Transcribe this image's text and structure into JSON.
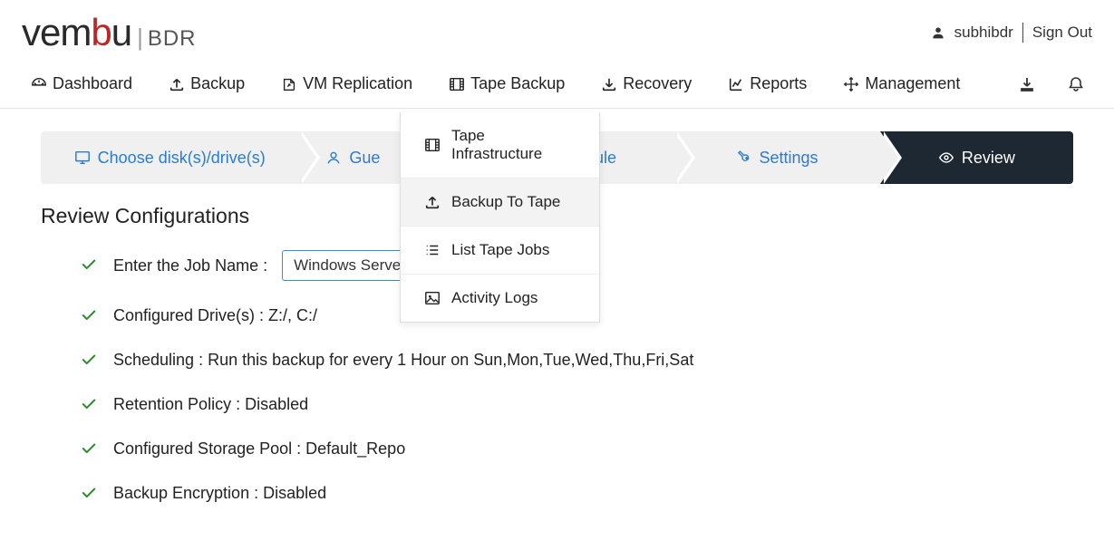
{
  "header": {
    "logo_main": "vembu",
    "logo_sep": "|",
    "logo_suffix": "BDR",
    "username": "subhibdr",
    "signout": "Sign Out"
  },
  "nav": {
    "items": [
      {
        "label": "Dashboard",
        "icon": "dashboard-icon"
      },
      {
        "label": "Backup",
        "icon": "upload-icon"
      },
      {
        "label": "VM Replication",
        "icon": "share-icon"
      },
      {
        "label": "Tape Backup",
        "icon": "film-icon"
      },
      {
        "label": "Recovery",
        "icon": "download-icon"
      },
      {
        "label": "Reports",
        "icon": "chart-icon"
      },
      {
        "label": "Management",
        "icon": "move-icon"
      }
    ]
  },
  "dropdown": {
    "items": [
      {
        "label": "Tape Infrastructure",
        "icon": "film-icon"
      },
      {
        "label": "Backup To Tape",
        "icon": "upload-icon",
        "active": true
      },
      {
        "label": "List Tape Jobs",
        "icon": "list-icon"
      },
      {
        "label": "Activity Logs",
        "icon": "image-icon"
      }
    ]
  },
  "steps": [
    {
      "label": "Choose disk(s)/drive(s)",
      "icon": "monitor-icon"
    },
    {
      "label": "Gue",
      "icon": "user-icon"
    },
    {
      "label": "Schedule",
      "icon": "calendar-icon"
    },
    {
      "label": "Settings",
      "icon": "wrench-icon"
    },
    {
      "label": "Review",
      "icon": "eye-icon",
      "active": true
    }
  ],
  "section_title": "Review Configurations",
  "config": {
    "job_label": "Enter the Job Name :",
    "job_value": "Windows Server",
    "items": [
      "Configured Drive(s) : Z:/, C:/",
      "Scheduling : Run this backup for every 1 Hour on Sun,Mon,Tue,Wed,Thu,Fri,Sat",
      "Retention Policy : Disabled",
      "Configured Storage Pool : Default_Repo",
      "Backup Encryption : Disabled"
    ]
  }
}
